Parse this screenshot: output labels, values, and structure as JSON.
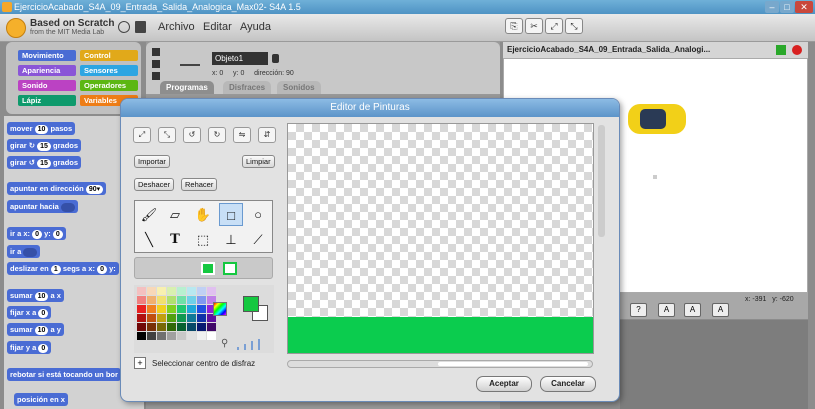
{
  "window": {
    "title": "EjercicioAcabado_S4A_09_Entrada_Salida_Analogica_Max02- S4A 1.5",
    "minimize": "–",
    "maximize": "□",
    "close": "✕"
  },
  "logo": {
    "line1": "Based on Scratch",
    "line2": "from the MIT Media Lab"
  },
  "menu": {
    "archivo": "Archivo",
    "editar": "Editar",
    "ayuda": "Ayuda"
  },
  "categories": {
    "movimiento": "Movimiento",
    "control": "Control",
    "apariencia": "Apariencia",
    "sensores": "Sensores",
    "sonido": "Sonido",
    "operadores": "Operadores",
    "lapiz": "Lápiz",
    "variables": "Variables"
  },
  "blocks": {
    "mover": {
      "pre": "mover",
      "val": "10",
      "post": "pasos"
    },
    "girar_r": {
      "pre": "girar ↻",
      "val": "15",
      "post": "grados"
    },
    "girar_l": {
      "pre": "girar ↺",
      "val": "15",
      "post": "grados"
    },
    "apuntar_dir": {
      "pre": "apuntar en dirección",
      "val": "90▾"
    },
    "apuntar_hacia": {
      "pre": "apuntar hacia"
    },
    "ir_a": {
      "pre": "ir a x:",
      "x": "0",
      "mid": "y:",
      "y": "0"
    },
    "ir_a2": {
      "pre": "ir a"
    },
    "deslizar": {
      "pre": "deslizar en",
      "val": "1",
      "post": "segs a x:",
      "x": "0",
      "mid": "y:"
    },
    "sumar_x": {
      "pre": "sumar",
      "val": "10",
      "post": "a x"
    },
    "fijar_x": {
      "pre": "fijar x a",
      "val": "0"
    },
    "sumar_y": {
      "pre": "sumar",
      "val": "10",
      "post": "a y"
    },
    "fijar_y": {
      "pre": "fijar y a",
      "val": "0"
    },
    "rebotar": "rebotar si está tocando un bor",
    "posicion_x": "posición en x"
  },
  "sprite": {
    "name": "Objeto1",
    "x_label": "x:",
    "x": "0",
    "y_label": "y:",
    "y": "0",
    "dir_label": "dirección:",
    "dir": "90"
  },
  "tabs": {
    "programas": "Programas",
    "disfraces": "Disfraces",
    "sonidos": "Sonidos"
  },
  "stage": {
    "title": "EjercicioAcabado_S4A_09_Entrada_Salida_Analogi...",
    "coords_x_label": "x:",
    "coords_x": "-391",
    "coords_y_label": "y:",
    "coords_y": "-620"
  },
  "paint_editor": {
    "title": "Editor de Pinturas",
    "importar": "Importar",
    "limpiar": "Limpiar",
    "deshacer": "Deshacer",
    "rehacer": "Rehacer",
    "center_label": "Seleccionar centro de disfraz",
    "aceptar": "Aceptar",
    "cancelar": "Cancelar",
    "foreground_color": "#15c840",
    "background_color": "#ffffff",
    "shape_fill_color": "#0bcc4e"
  },
  "swatch_colors": [
    "#f4c0c0",
    "#f8d8b8",
    "#f8f0b0",
    "#d8f0b0",
    "#b8f0d0",
    "#b8e8f0",
    "#c0d0f4",
    "#e0c0f0",
    "#f08080",
    "#f0b070",
    "#f0e070",
    "#b0e070",
    "#70e0a8",
    "#70d0e8",
    "#8098f0",
    "#c080e8",
    "#e82020",
    "#f08020",
    "#f0d020",
    "#80d020",
    "#20c870",
    "#20a8d8",
    "#2050e0",
    "#9020d8",
    "#b01010",
    "#c05010",
    "#c0a010",
    "#50a010",
    "#109850",
    "#107898",
    "#1030a8",
    "#6010a0",
    "#700808",
    "#783008",
    "#786808",
    "#306808",
    "#086030",
    "#084868",
    "#081870",
    "#400868",
    "#000000",
    "#404040",
    "#707070",
    "#a0a0a0",
    "#c8c8c8",
    "#e0e0e0",
    "#f0f0f0",
    "#ffffff"
  ]
}
